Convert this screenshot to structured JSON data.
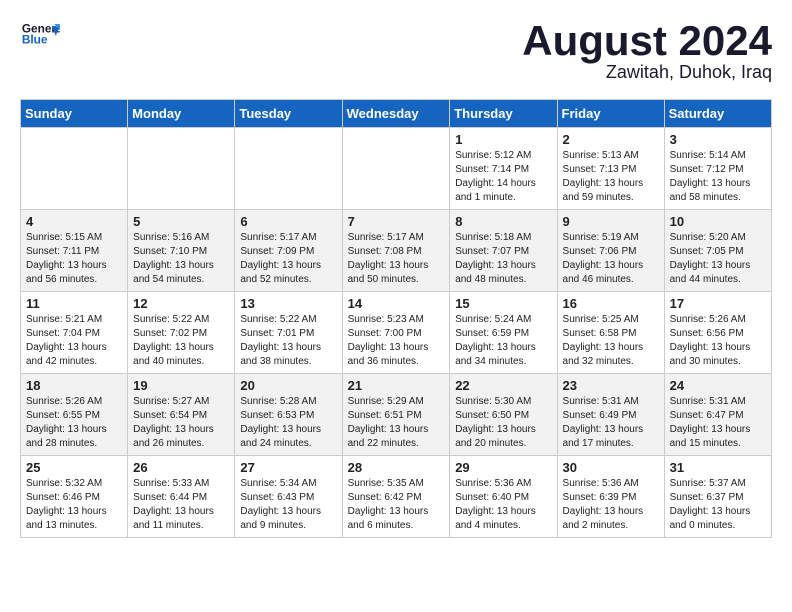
{
  "header": {
    "logo_line1": "General",
    "logo_line2": "Blue",
    "month": "August 2024",
    "location": "Zawitah, Duhok, Iraq"
  },
  "days_of_week": [
    "Sunday",
    "Monday",
    "Tuesday",
    "Wednesday",
    "Thursday",
    "Friday",
    "Saturday"
  ],
  "weeks": [
    [
      {
        "day": "",
        "detail": ""
      },
      {
        "day": "",
        "detail": ""
      },
      {
        "day": "",
        "detail": ""
      },
      {
        "day": "",
        "detail": ""
      },
      {
        "day": "1",
        "detail": "Sunrise: 5:12 AM\nSunset: 7:14 PM\nDaylight: 14 hours\nand 1 minute."
      },
      {
        "day": "2",
        "detail": "Sunrise: 5:13 AM\nSunset: 7:13 PM\nDaylight: 13 hours\nand 59 minutes."
      },
      {
        "day": "3",
        "detail": "Sunrise: 5:14 AM\nSunset: 7:12 PM\nDaylight: 13 hours\nand 58 minutes."
      }
    ],
    [
      {
        "day": "4",
        "detail": "Sunrise: 5:15 AM\nSunset: 7:11 PM\nDaylight: 13 hours\nand 56 minutes."
      },
      {
        "day": "5",
        "detail": "Sunrise: 5:16 AM\nSunset: 7:10 PM\nDaylight: 13 hours\nand 54 minutes."
      },
      {
        "day": "6",
        "detail": "Sunrise: 5:17 AM\nSunset: 7:09 PM\nDaylight: 13 hours\nand 52 minutes."
      },
      {
        "day": "7",
        "detail": "Sunrise: 5:17 AM\nSunset: 7:08 PM\nDaylight: 13 hours\nand 50 minutes."
      },
      {
        "day": "8",
        "detail": "Sunrise: 5:18 AM\nSunset: 7:07 PM\nDaylight: 13 hours\nand 48 minutes."
      },
      {
        "day": "9",
        "detail": "Sunrise: 5:19 AM\nSunset: 7:06 PM\nDaylight: 13 hours\nand 46 minutes."
      },
      {
        "day": "10",
        "detail": "Sunrise: 5:20 AM\nSunset: 7:05 PM\nDaylight: 13 hours\nand 44 minutes."
      }
    ],
    [
      {
        "day": "11",
        "detail": "Sunrise: 5:21 AM\nSunset: 7:04 PM\nDaylight: 13 hours\nand 42 minutes."
      },
      {
        "day": "12",
        "detail": "Sunrise: 5:22 AM\nSunset: 7:02 PM\nDaylight: 13 hours\nand 40 minutes."
      },
      {
        "day": "13",
        "detail": "Sunrise: 5:22 AM\nSunset: 7:01 PM\nDaylight: 13 hours\nand 38 minutes."
      },
      {
        "day": "14",
        "detail": "Sunrise: 5:23 AM\nSunset: 7:00 PM\nDaylight: 13 hours\nand 36 minutes."
      },
      {
        "day": "15",
        "detail": "Sunrise: 5:24 AM\nSunset: 6:59 PM\nDaylight: 13 hours\nand 34 minutes."
      },
      {
        "day": "16",
        "detail": "Sunrise: 5:25 AM\nSunset: 6:58 PM\nDaylight: 13 hours\nand 32 minutes."
      },
      {
        "day": "17",
        "detail": "Sunrise: 5:26 AM\nSunset: 6:56 PM\nDaylight: 13 hours\nand 30 minutes."
      }
    ],
    [
      {
        "day": "18",
        "detail": "Sunrise: 5:26 AM\nSunset: 6:55 PM\nDaylight: 13 hours\nand 28 minutes."
      },
      {
        "day": "19",
        "detail": "Sunrise: 5:27 AM\nSunset: 6:54 PM\nDaylight: 13 hours\nand 26 minutes."
      },
      {
        "day": "20",
        "detail": "Sunrise: 5:28 AM\nSunset: 6:53 PM\nDaylight: 13 hours\nand 24 minutes."
      },
      {
        "day": "21",
        "detail": "Sunrise: 5:29 AM\nSunset: 6:51 PM\nDaylight: 13 hours\nand 22 minutes."
      },
      {
        "day": "22",
        "detail": "Sunrise: 5:30 AM\nSunset: 6:50 PM\nDaylight: 13 hours\nand 20 minutes."
      },
      {
        "day": "23",
        "detail": "Sunrise: 5:31 AM\nSunset: 6:49 PM\nDaylight: 13 hours\nand 17 minutes."
      },
      {
        "day": "24",
        "detail": "Sunrise: 5:31 AM\nSunset: 6:47 PM\nDaylight: 13 hours\nand 15 minutes."
      }
    ],
    [
      {
        "day": "25",
        "detail": "Sunrise: 5:32 AM\nSunset: 6:46 PM\nDaylight: 13 hours\nand 13 minutes."
      },
      {
        "day": "26",
        "detail": "Sunrise: 5:33 AM\nSunset: 6:44 PM\nDaylight: 13 hours\nand 11 minutes."
      },
      {
        "day": "27",
        "detail": "Sunrise: 5:34 AM\nSunset: 6:43 PM\nDaylight: 13 hours\nand 9 minutes."
      },
      {
        "day": "28",
        "detail": "Sunrise: 5:35 AM\nSunset: 6:42 PM\nDaylight: 13 hours\nand 6 minutes."
      },
      {
        "day": "29",
        "detail": "Sunrise: 5:36 AM\nSunset: 6:40 PM\nDaylight: 13 hours\nand 4 minutes."
      },
      {
        "day": "30",
        "detail": "Sunrise: 5:36 AM\nSunset: 6:39 PM\nDaylight: 13 hours\nand 2 minutes."
      },
      {
        "day": "31",
        "detail": "Sunrise: 5:37 AM\nSunset: 6:37 PM\nDaylight: 13 hours\nand 0 minutes."
      }
    ]
  ]
}
